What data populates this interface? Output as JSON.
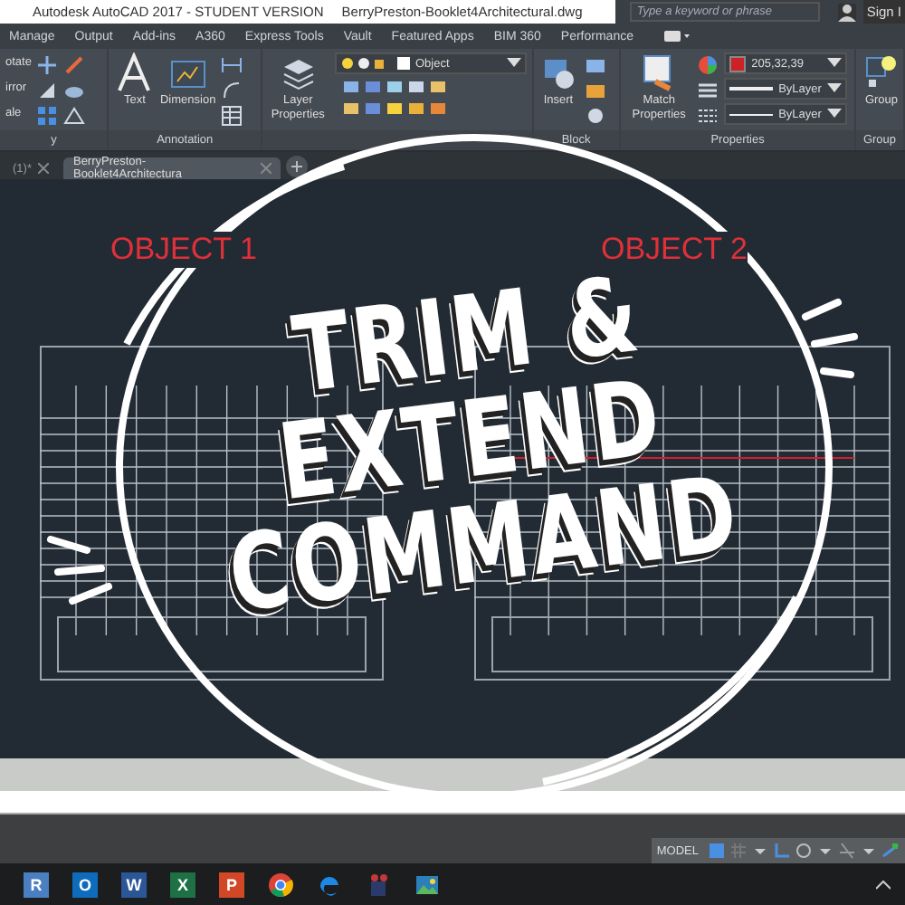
{
  "title_bar": {
    "app": "Autodesk AutoCAD 2017 - STUDENT VERSION",
    "file": "BerryPreston-Booklet4Architectural.dwg",
    "search": {
      "placeholder": "Type a keyword or phrase"
    },
    "sign_in": "Sign I"
  },
  "ribbon_tabs": [
    "Manage",
    "Output",
    "Add-ins",
    "A360",
    "Express Tools",
    "Vault",
    "Featured Apps",
    "BIM 360",
    "Performance"
  ],
  "ribbon": {
    "modify": {
      "items": [
        "otate",
        "irror",
        "ale"
      ],
      "title": "y"
    },
    "annotation": {
      "buttons": [
        "Text",
        "Dimension"
      ],
      "title": "Annotation"
    },
    "layers": {
      "button": "Layer Properties",
      "layer": "Object"
    },
    "block": {
      "button": "Insert",
      "title": "Block"
    },
    "properties": {
      "button": "Match Properties",
      "color": "#cd2027",
      "color_value": "205,32,39",
      "lineweight": "ByLayer",
      "linetype": "ByLayer",
      "title": "Properties"
    },
    "groups": {
      "button": "Group",
      "title": "Group"
    }
  },
  "file_tabs": [
    {
      "label": "(1)*",
      "selected": false
    },
    {
      "label": "BerryPreston-Booklet4Architectura",
      "selected": true
    }
  ],
  "drawing": {
    "labels": [
      "OBJECT 1",
      "OBJECT 2"
    ]
  },
  "overlay": {
    "lines": [
      "TRIM &",
      "EXTEND",
      "COMMAND"
    ]
  },
  "status_bar": {
    "mode": "MODEL"
  },
  "taskbar": [
    {
      "kind": "letter",
      "letter": "R",
      "color": "#4a7fc1"
    },
    {
      "kind": "letter",
      "letter": "O",
      "color": "#0f6cbd"
    },
    {
      "kind": "letter",
      "letter": "W",
      "color": "#2b5797"
    },
    {
      "kind": "letter",
      "letter": "X",
      "color": "#1e7145"
    },
    {
      "kind": "letter",
      "letter": "P",
      "color": "#d24726"
    },
    {
      "kind": "chrome"
    },
    {
      "kind": "edge"
    },
    {
      "kind": "film"
    },
    {
      "kind": "photo"
    }
  ]
}
